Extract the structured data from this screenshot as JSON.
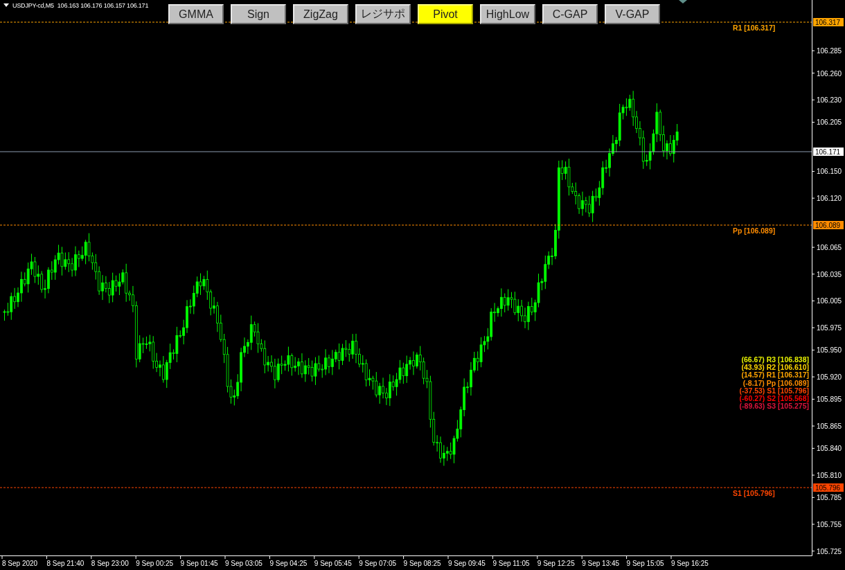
{
  "chart": {
    "symbol": "USDJPY-cd,M5",
    "ohlc": "106.163 106.176 106.157 106.171"
  },
  "buttons": [
    {
      "label": "GMMA",
      "selected": false
    },
    {
      "label": "Sign",
      "selected": false
    },
    {
      "label": "ZigZag",
      "selected": false
    },
    {
      "label": "レジサポ",
      "selected": false
    },
    {
      "label": "Pivot",
      "selected": true
    },
    {
      "label": "HighLow",
      "selected": false
    },
    {
      "label": "C-GAP",
      "selected": false
    },
    {
      "label": "V-GAP",
      "selected": false
    }
  ],
  "price_axis": {
    "ticks": [
      "106.285",
      "106.260",
      "106.230",
      "106.205",
      "106.150",
      "106.120",
      "106.065",
      "106.035",
      "106.005",
      "105.975",
      "105.950",
      "105.920",
      "105.895",
      "105.865",
      "105.840",
      "105.810",
      "105.785",
      "105.755",
      "105.725"
    ]
  },
  "time_axis": {
    "ticks": [
      "8 Sep 2020",
      "8 Sep 21:40",
      "8 Sep 23:00",
      "9 Sep 00:25",
      "9 Sep 01:45",
      "9 Sep 03:05",
      "9 Sep 04:25",
      "9 Sep 05:45",
      "9 Sep 07:05",
      "9 Sep 08:25",
      "9 Sep 09:45",
      "9 Sep 11:05",
      "9 Sep 12:25",
      "9 Sep 13:45",
      "9 Sep 15:05",
      "9 Sep 16:25"
    ]
  },
  "lines": [
    {
      "kind": "level",
      "label": "R1 [106.317]",
      "marker": "106.317",
      "color": "#ffa500"
    },
    {
      "kind": "current",
      "marker": "106.171"
    },
    {
      "kind": "level",
      "label": "Pp [106.089]",
      "marker": "106.089",
      "color": "#ff8c00"
    },
    {
      "kind": "level",
      "label": "S1 [105.796]",
      "marker": "105.796",
      "color": "#ff4500"
    }
  ],
  "pivot_table": [
    {
      "text": "(66.67) R3 [106.838]",
      "color": "#e6f000"
    },
    {
      "text": "(43.93) R2 [106.610]",
      "color": "#ffd700"
    },
    {
      "text": "(14.57) R1 [106.317]",
      "color": "#ffa500"
    },
    {
      "text": "(-8.17) Pp [106.089]",
      "color": "#ff8c00"
    },
    {
      "text": "(-37.53) S1 [105.796]",
      "color": "#ff4500"
    },
    {
      "text": "(-60.27) S2 [105.568]",
      "color": "#ff0000"
    },
    {
      "text": "(-89.63) S3 [105.275]",
      "color": "#dc143c"
    }
  ]
}
